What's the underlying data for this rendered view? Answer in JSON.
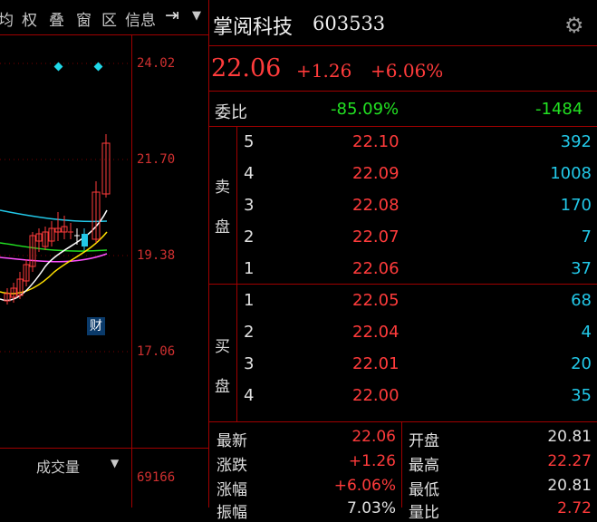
{
  "toolbar": {
    "items": [
      "均",
      "权",
      "叠",
      "窗",
      "区",
      "信息"
    ]
  },
  "price_ticks": [
    "24.02",
    "21.70",
    "19.38",
    "17.06"
  ],
  "volume": {
    "label": "成交量",
    "value": "69166"
  },
  "finance_badge": "财",
  "quote": {
    "name": "掌阅科技",
    "code": "603533",
    "last": "22.06",
    "change": "+1.26",
    "change_pct": "+6.06%",
    "weibi_label": "委比",
    "weibi_ratio": "-85.09%",
    "weibi_diff": "-1484",
    "sell_label": [
      "卖",
      "盘"
    ],
    "buy_label": [
      "买",
      "盘"
    ],
    "sell": [
      {
        "level": "5",
        "price": "22.10",
        "vol": "392"
      },
      {
        "level": "4",
        "price": "22.09",
        "vol": "1008"
      },
      {
        "level": "3",
        "price": "22.08",
        "vol": "170"
      },
      {
        "level": "2",
        "price": "22.07",
        "vol": "7"
      },
      {
        "level": "1",
        "price": "22.06",
        "vol": "37"
      }
    ],
    "buy": [
      {
        "level": "1",
        "price": "22.05",
        "vol": "68"
      },
      {
        "level": "2",
        "price": "22.04",
        "vol": "4"
      },
      {
        "level": "3",
        "price": "22.01",
        "vol": "20"
      },
      {
        "level": "4",
        "price": "22.00",
        "vol": "35"
      }
    ],
    "stats": {
      "latest_label": "最新",
      "latest": "22.06",
      "open_label": "开盘",
      "open": "20.81",
      "change_label": "涨跌",
      "change": "+1.26",
      "high_label": "最高",
      "high": "22.27",
      "pct_label": "涨幅",
      "pct": "+6.06%",
      "low_label": "最低",
      "low": "20.81",
      "amp_label": "振幅",
      "amp": "7.03%",
      "volratio_label": "量比",
      "volratio": "2.72"
    }
  },
  "colors": {
    "up": "#ff3b3b",
    "down": "#22e022",
    "volume": "#22c8e8",
    "grid": "#a00000"
  }
}
